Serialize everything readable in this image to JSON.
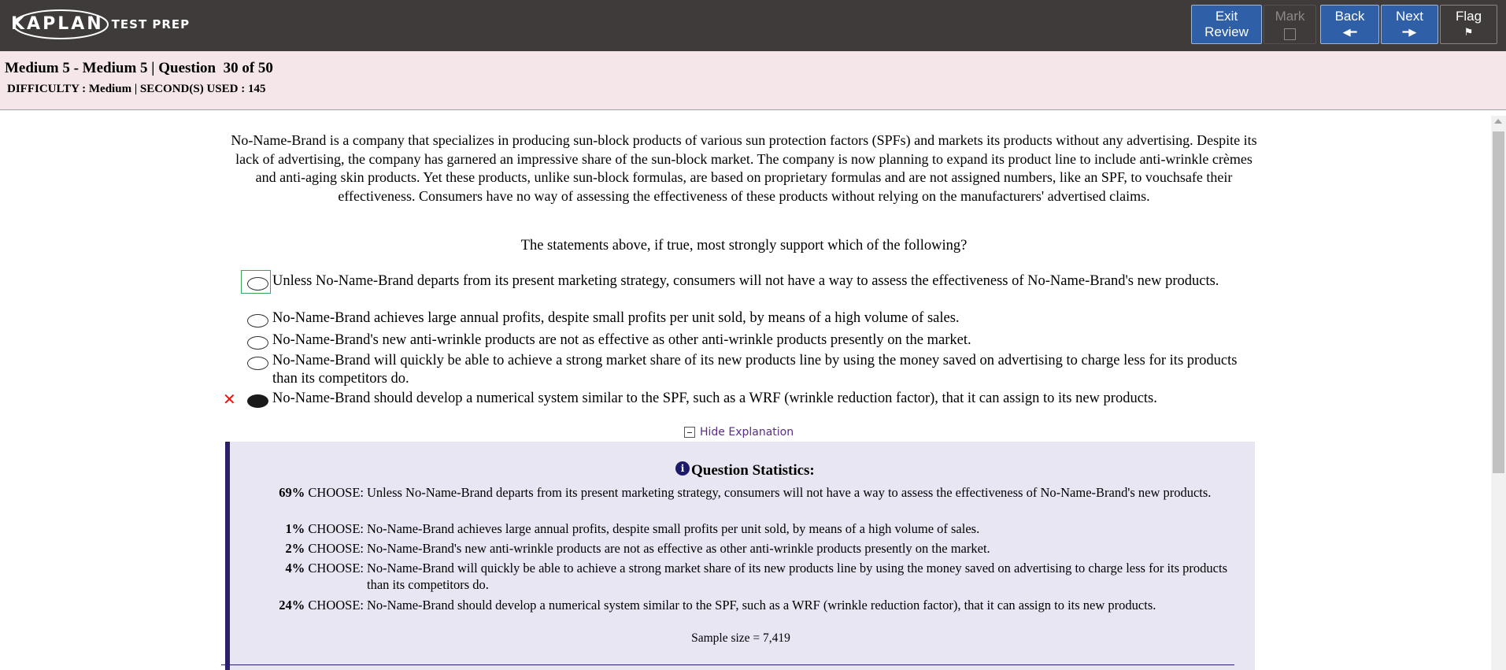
{
  "brand": {
    "name": "KAPLAN",
    "sub": "TEST PREP"
  },
  "toolbar": {
    "exit_label_1": "Exit",
    "exit_label_2": "Review",
    "mark_label": "Mark",
    "back_label": "Back",
    "next_label": "Next",
    "flag_label": "Flag",
    "back_arrow": "◀━",
    "next_arrow": "━▶",
    "flag_glyph": "⚑"
  },
  "header": {
    "title": "Medium 5 - Medium 5 | Question  30 of 50",
    "meta": "DIFFICULTY : Medium | SECOND(S) USED : 145"
  },
  "question": {
    "passage": "No-Name-Brand is a company that specializes in producing sun-block products of various sun protection factors (SPFs) and markets its products without any advertising. Despite its lack of advertising, the company has garnered an impressive share of the sun-block market. The company is now planning to expand its product line to include anti-wrinkle crèmes and anti-aging skin products. Yet these products, unlike sun-block formulas, are based on proprietary formulas and are not assigned numbers, like an SPF, to vouchsafe their effectiveness. Consumers have no way of assessing the effectiveness of these products without relying on the manufacturers' advertised claims.",
    "stem": "The statements above, if true, most strongly support which of the following?",
    "choices": [
      {
        "text": "Unless No-Name-Brand departs from its present marketing strategy, consumers will not have a way to assess the effectiveness of No-Name-Brand's new products.",
        "selected": false
      },
      {
        "text": "No-Name-Brand achieves large annual profits, despite small profits per unit sold, by means of a high volume of sales.",
        "selected": false
      },
      {
        "text": "No-Name-Brand's new anti-wrinkle products are not as effective as other anti-wrinkle products presently on the market.",
        "selected": false
      },
      {
        "text": "No-Name-Brand will quickly be able to achieve a strong market share of its new products line by using the money saved on advertising to charge less for its products than its competitors do.",
        "selected": false
      },
      {
        "text": "No-Name-Brand should develop a numerical system similar to the SPF, such as a WRF (wrinkle reduction factor), that it can assign to its new products.",
        "selected": true
      }
    ],
    "wrong_mark": "✕"
  },
  "explanation": {
    "toggle_label": "Hide Explanation",
    "info_glyph": "i",
    "stats_title": "Question Statistics:",
    "choose_label": "CHOOSE:",
    "stats": [
      {
        "pct": "69%",
        "text": "Unless No-Name-Brand departs from its present marketing strategy, consumers will not have a way to assess the effectiveness of No-Name-Brand's new products."
      },
      {
        "pct": "1%",
        "text": "No-Name-Brand achieves large annual profits, despite small profits per unit sold, by means of a high volume of sales."
      },
      {
        "pct": "2%",
        "text": "No-Name-Brand's new anti-wrinkle products are not as effective as other anti-wrinkle products presently on the market."
      },
      {
        "pct": "4%",
        "text": "No-Name-Brand will quickly be able to achieve a strong market share of its new products line by using the money saved on advertising to charge less for its products than its competitors do."
      },
      {
        "pct": "24%",
        "text": "No-Name-Brand should develop a numerical system similar to the SPF, such as a WRF (wrinkle reduction factor), that it can assign to its new products."
      }
    ],
    "sample": "Sample size = 7,419"
  },
  "colors": {
    "topbar": "#3f3b3a",
    "button": "#2f5fa7",
    "header_band": "#f4e6e9",
    "explanation_bg": "#e8e6f2",
    "wrong": "#ee1111"
  }
}
